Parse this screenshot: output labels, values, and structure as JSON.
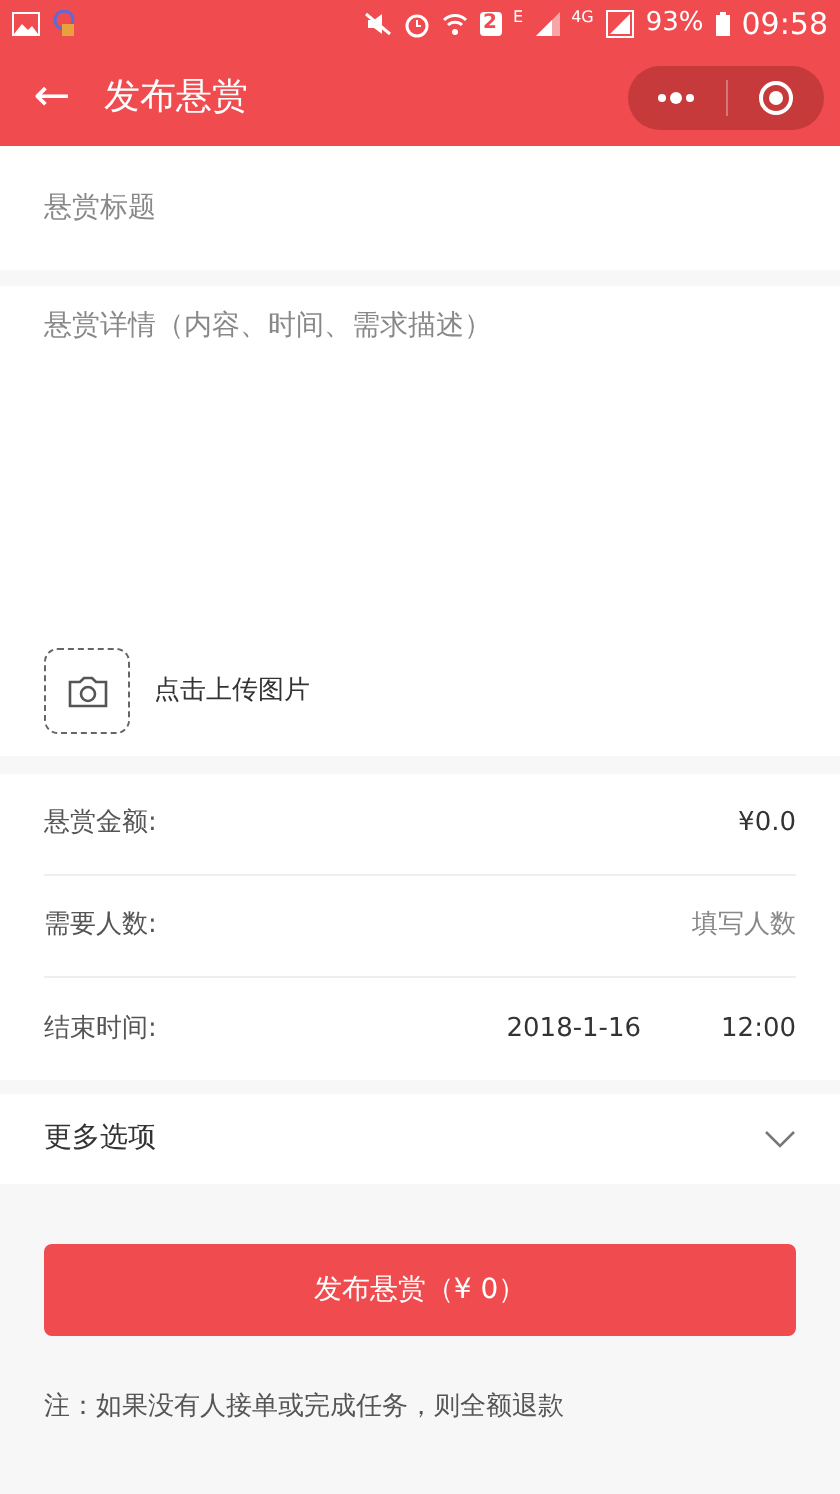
{
  "status_bar": {
    "sim_badge": "2",
    "network_1": "E",
    "network_2": "4G",
    "battery": "93%",
    "time": "09:58"
  },
  "header": {
    "back": "←",
    "title": "发布悬赏"
  },
  "title_field": {
    "placeholder": "悬赏标题"
  },
  "details_field": {
    "placeholder": "悬赏详情（内容、时间、需求描述）"
  },
  "upload": {
    "label": "点击上传图片"
  },
  "rows": [
    {
      "kind": "value",
      "label": "悬赏金额:",
      "value": "¥0.0"
    },
    {
      "kind": "input",
      "label": "需要人数:",
      "placeholder": "填写人数"
    },
    {
      "kind": "datetime",
      "label": "结束时间:",
      "date": "2018-1-16",
      "time": "12:00"
    }
  ],
  "more_options": {
    "label": "更多选项",
    "expanded": false
  },
  "submit_button": "发布悬赏（¥ 0）",
  "note": "注：如果没有人接单或完成任务，则全额退款"
}
